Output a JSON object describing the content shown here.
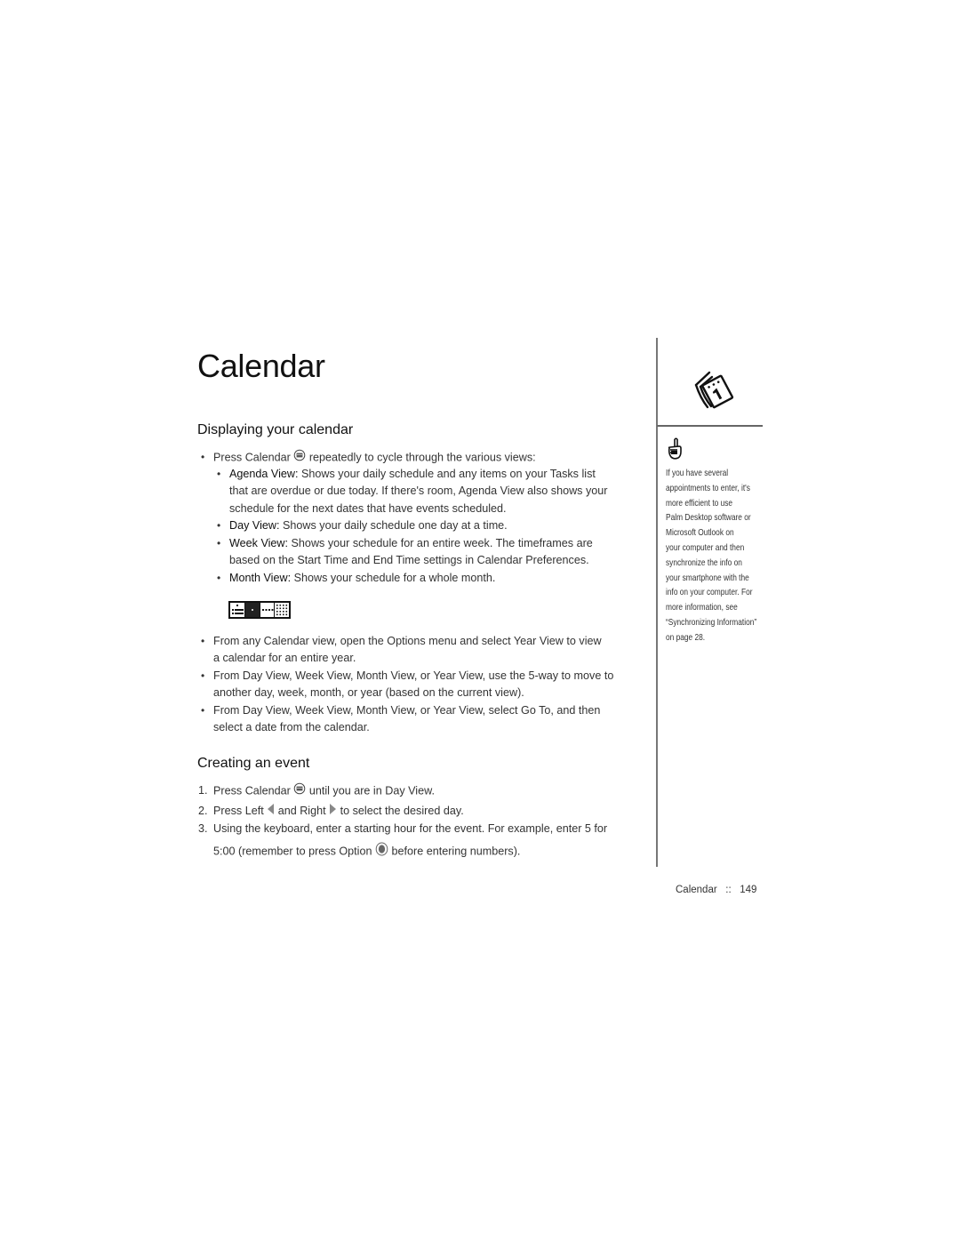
{
  "page": {
    "title": "Calendar",
    "footer": {
      "section": "Calendar",
      "separator": "::",
      "page_number": "149"
    }
  },
  "displaying": {
    "heading": "Displaying your calendar",
    "intro": {
      "before": "Press Calendar",
      "icon": "calendar-button-icon",
      "after": "repeatedly to cycle through the various views:"
    },
    "views": [
      {
        "term": "Agenda View:",
        "lines": [
          "Shows your daily schedule and any items on your Tasks list",
          "that are overdue or due today. If there's room, Agenda View also shows your",
          "schedule for the next dates that have events scheduled."
        ]
      },
      {
        "term": "Day View:",
        "lines": [
          "Shows your daily schedule one day at a time."
        ]
      },
      {
        "term": "Week View:",
        "lines": [
          "Shows your schedule for an entire week. The timeframes are",
          "based on the Start Time and End Time settings in Calendar Preferences."
        ]
      },
      {
        "term": "Month View:",
        "lines": [
          "Shows your schedule for a whole month."
        ]
      }
    ],
    "view_selector_icons": [
      "agenda-view-icon",
      "day-view-icon",
      "week-view-icon",
      "month-view-icon"
    ],
    "view_selector_active": 1,
    "more_bullets": [
      {
        "lines": [
          "From any Calendar view, open the Options menu and select Year View to view",
          "a calendar for an entire year."
        ]
      },
      {
        "lines": [
          "From Day View, Week View, Month View, or Year View, use the 5-way to move to",
          "another day, week, month, or year (based on the current view)."
        ]
      },
      {
        "lines": [
          "From Day View, Week View, Month View, or Year View, select Go To, and then",
          "select a date from the calendar."
        ]
      }
    ]
  },
  "creating": {
    "heading": "Creating an event",
    "steps": [
      {
        "num": "1.",
        "before": "Press Calendar",
        "icon": "calendar-button-icon",
        "after": "until you are in Day View."
      },
      {
        "num": "2.",
        "part1": "Press Left",
        "icon1": "left-arrow-icon",
        "part2": "and Right",
        "icon2": "right-arrow-icon",
        "part3": "to select the desired day."
      },
      {
        "num": "3.",
        "line1": "Using the keyboard, enter a starting hour for the event. For example, enter 5 for",
        "line2_before": "5:00 (remember to press Option",
        "icon": "option-key-icon",
        "line2_after": "before entering numbers)."
      }
    ]
  },
  "sidebar": {
    "chapter_icon": "calendar-chapter-icon",
    "tip_icon": "pointing-hand-tip-icon",
    "tip_lines": [
      "If you have several",
      "appointments to enter, it's",
      "more efficient to use",
      "Palm Desktop software or",
      "Microsoft Outlook on",
      "your computer and then",
      "synchronize the info on",
      "your smartphone with the",
      "info on your computer. For",
      "more information, see",
      "“Synchronizing Information”",
      "on page 28."
    ]
  }
}
